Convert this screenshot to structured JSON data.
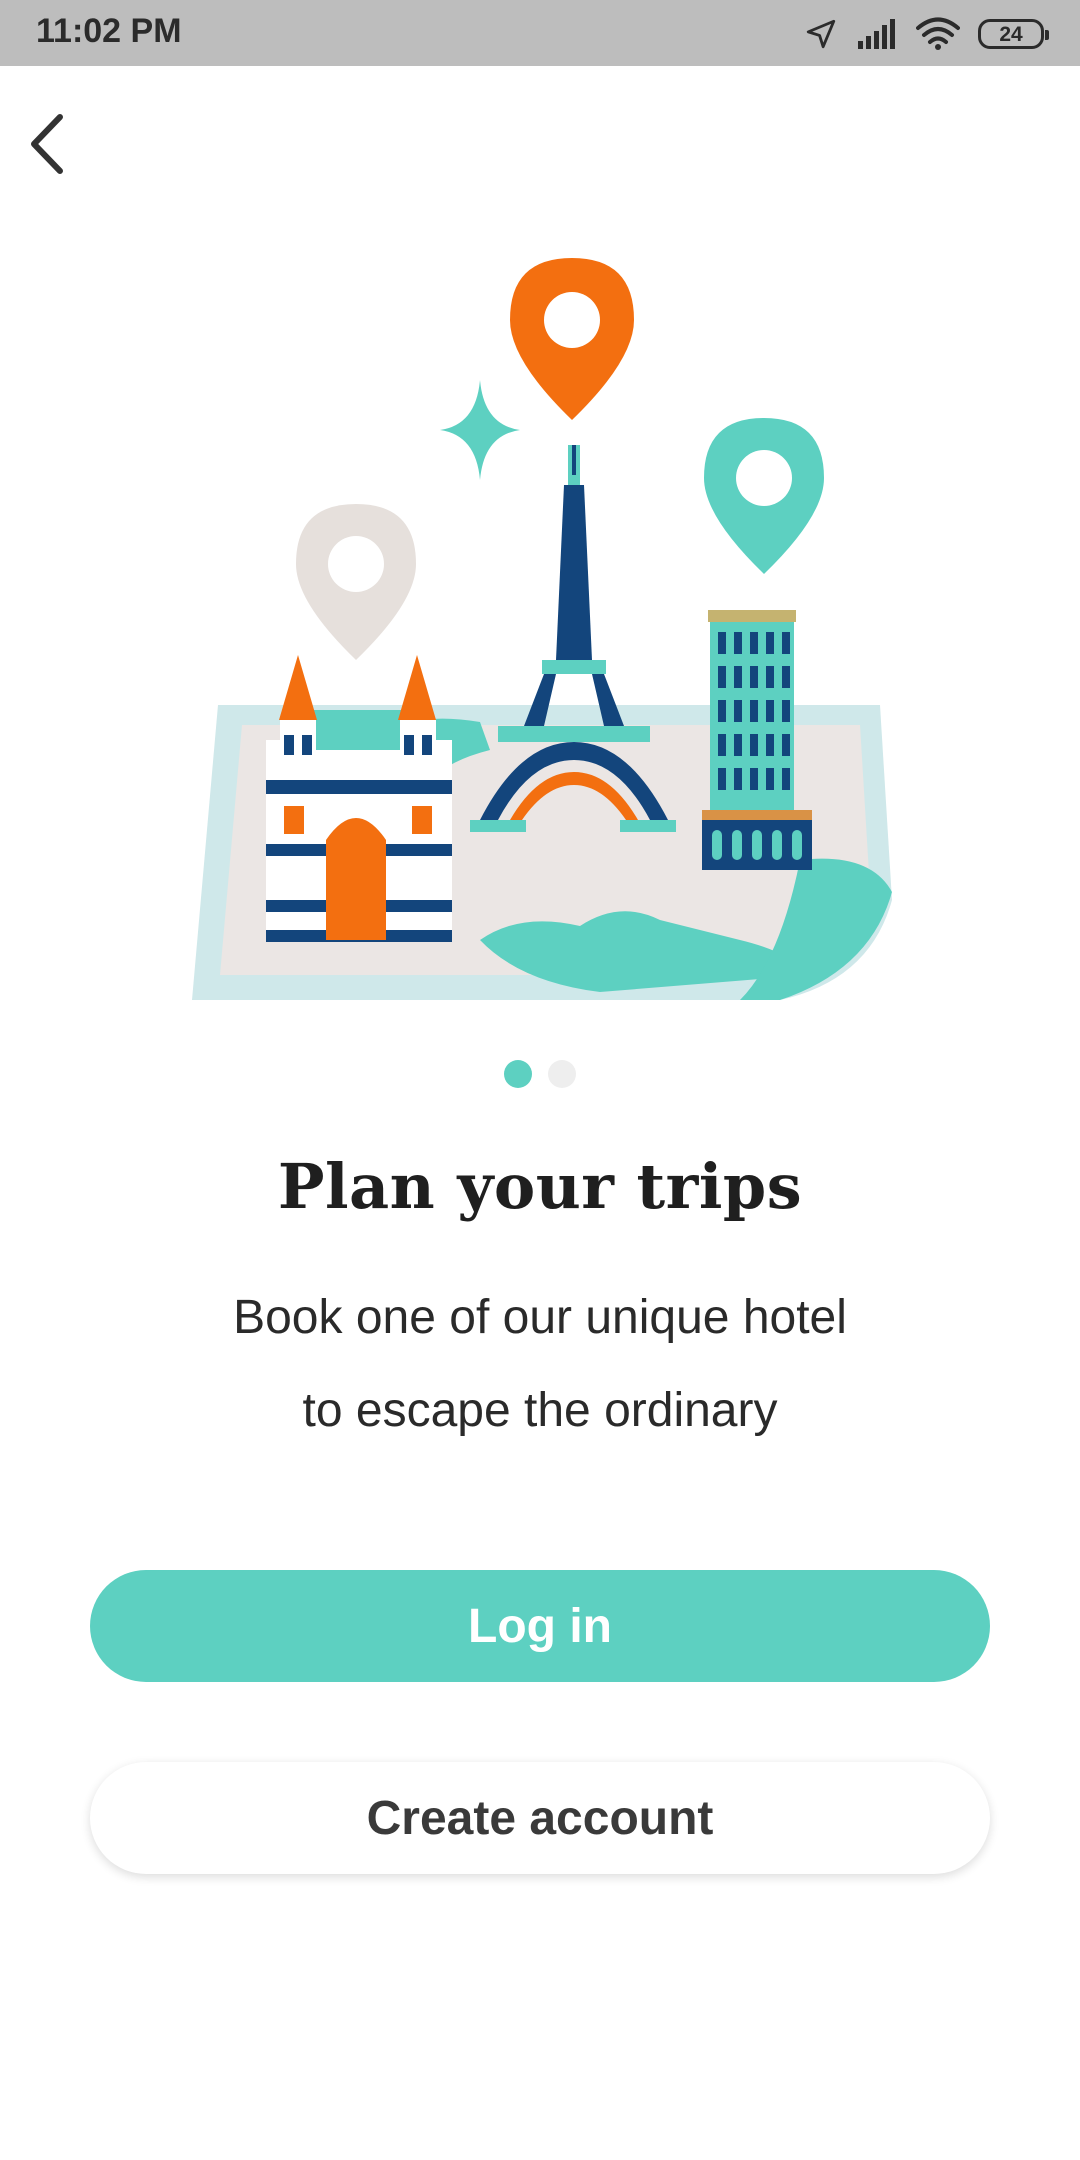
{
  "status_bar": {
    "time": "11:02 PM",
    "battery": "24",
    "icons": [
      "location-arrow-icon",
      "signal-icon",
      "wifi-icon",
      "battery-icon"
    ]
  },
  "nav": {
    "back_icon": "chevron-left-icon"
  },
  "onboarding": {
    "illustration": "travel-landmarks-map",
    "pager": {
      "total": 2,
      "active_index": 0
    },
    "title": "Plan your trips",
    "subtitle_line1": "Book one of our unique hotel",
    "subtitle_line2": "to escape the ordinary"
  },
  "actions": {
    "login_label": "Log in",
    "create_account_label": "Create account"
  },
  "colors": {
    "accent": "#5dd0c1",
    "orange": "#f36f10",
    "navy": "#13457c",
    "status_bar": "#bdbdbd"
  }
}
